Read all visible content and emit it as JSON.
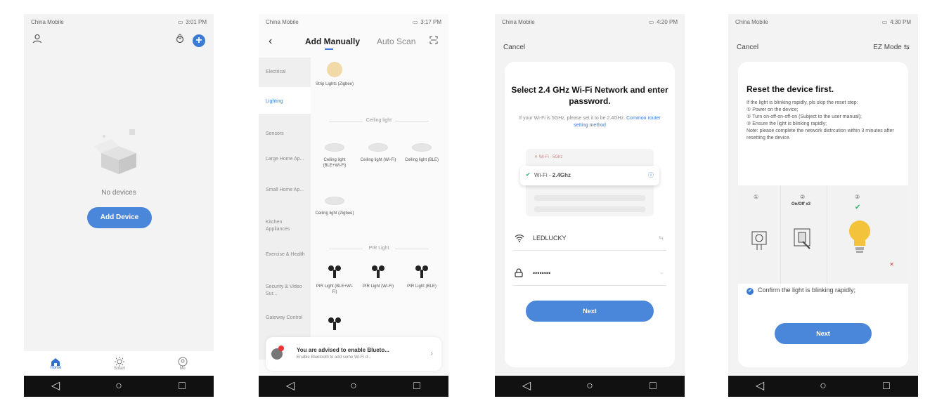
{
  "status": {
    "carrier": "China Mobile",
    "time1": "3:01 PM",
    "time2": "3:17 PM",
    "time3": "4:20 PM",
    "time4": "4:30 PM"
  },
  "phone1": {
    "empty_text": "No devices",
    "add_button": "Add Device",
    "tabs": [
      "Home",
      "Smart",
      "Me"
    ]
  },
  "phone2": {
    "tab_manual": "Add Manually",
    "tab_auto": "Auto Scan",
    "categories": [
      "Electrical",
      "Lighting",
      "Sensors",
      "Large Home Ap...",
      "Small Home Ap...",
      "Kitchen Appliances",
      "Exercise & Health",
      "Security & Video Sur...",
      "Gateway Control"
    ],
    "strip_light": "Strip Lights (Zigbee)",
    "section_ceiling": "Ceiling light",
    "ceiling_items": [
      "Ceiling light (BLE+Wi-Fi)",
      "Ceiling light (Wi-Fi)",
      "Ceiling light (BLE)",
      "Ceiling light (Zigbee)"
    ],
    "section_pir": "PIR Light",
    "pir_items": [
      "PIR Light (BLE+Wi-Fi)",
      "PIR Light (Wi-Fi)",
      "PIR Light (BLE)"
    ],
    "banner_title": "You are advised to enable Blueto...",
    "banner_sub": "Enable Bluetooth to add some Wi-Fi d..."
  },
  "phone3": {
    "cancel": "Cancel",
    "title": "Select 2.4 GHz Wi-Fi Network and enter password.",
    "desc": "If your Wi-Fi is 5GHz, please set it to be 2.4GHz.",
    "desc_link": "Common router setting method",
    "wifi_5g": "Wi-Fi - 5Ghz",
    "wifi_24_prefix": "Wi-Fi - ",
    "wifi_24": "2.4Ghz",
    "ssid": "LEDLUCKY",
    "password": "••••••••",
    "next": "Next"
  },
  "phone4": {
    "cancel": "Cancel",
    "mode": "EZ Mode",
    "title": "Reset the device first.",
    "steps": [
      "If the light is blinking rapidly, pls skip the reset step:",
      "① Power on the device;",
      "② Turn on-off-on-off-on (Subject to the user manual);",
      "③ Ensure the light is blinking rapidly;",
      "Note: please complete the network distrcution within 3 minutes after resetting the device."
    ],
    "illu_label": "On/Off x3",
    "confirm": "Confirm the light is blinking rapidly;",
    "next": "Next"
  }
}
